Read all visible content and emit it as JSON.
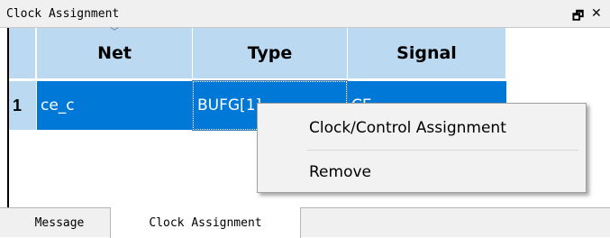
{
  "panel": {
    "title": "Clock Assignment",
    "float_icon": "restore-icon",
    "close_icon": "close-icon"
  },
  "grid": {
    "columns": [
      "Net",
      "Type",
      "Signal"
    ],
    "rows": [
      {
        "number": "1",
        "net": "ce_c",
        "type": "BUFG[1]",
        "signal": "CE"
      }
    ]
  },
  "context_menu": {
    "items": [
      "Clock/Control Assignment",
      "Remove"
    ]
  },
  "tabs": [
    {
      "label": "Message",
      "active": false
    },
    {
      "label": "Clock Assignment",
      "active": true
    }
  ],
  "colors": {
    "header_bg": "#bcd9f2",
    "selection": "#0078d7",
    "menu_bg": "#f2f2f2"
  }
}
